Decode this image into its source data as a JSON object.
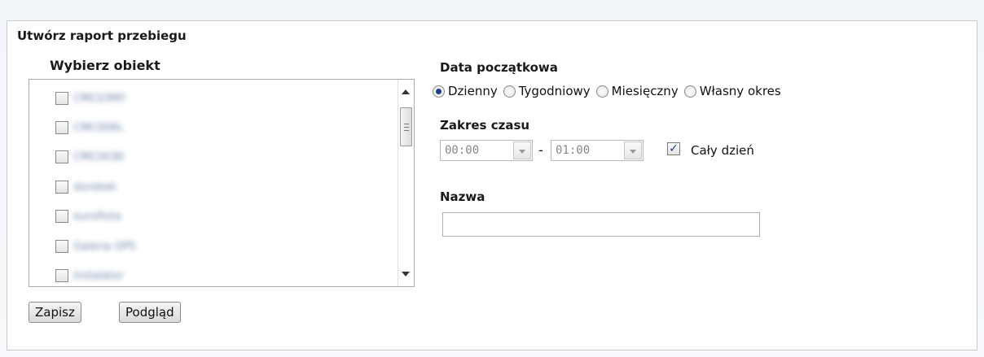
{
  "title": "Utwórz raport przebiegu",
  "object_select": {
    "label": "Wybierz obiekt",
    "items": [
      {
        "name": "CMC03MY",
        "checked": false
      },
      {
        "name": "CMC006L",
        "checked": false
      },
      {
        "name": "CMC003K",
        "checked": false
      },
      {
        "name": "dorobek",
        "checked": false
      },
      {
        "name": "euroflota",
        "checked": false
      },
      {
        "name": "Galeria GPS",
        "checked": false
      },
      {
        "name": "Instalator",
        "checked": false
      }
    ]
  },
  "buttons": {
    "save": "Zapisz",
    "preview": "Podgląd"
  },
  "start_date": {
    "label": "Data początkowa",
    "options": [
      {
        "label": "Dzienny",
        "selected": true
      },
      {
        "label": "Tygodniowy",
        "selected": false
      },
      {
        "label": "Miesięczny",
        "selected": false
      },
      {
        "label": "Własny okres",
        "selected": false
      }
    ]
  },
  "time_range": {
    "label": "Zakres czasu",
    "from": "00:00",
    "separator": "-",
    "to": "01:00",
    "all_day_label": "Cały dzień",
    "all_day_checked": true,
    "check_glyph": "✓"
  },
  "name_field": {
    "label": "Nazwa",
    "value": ""
  },
  "colors": {
    "radio_selected": "#1d3f8a",
    "checkmark": "#1d3f8a"
  }
}
